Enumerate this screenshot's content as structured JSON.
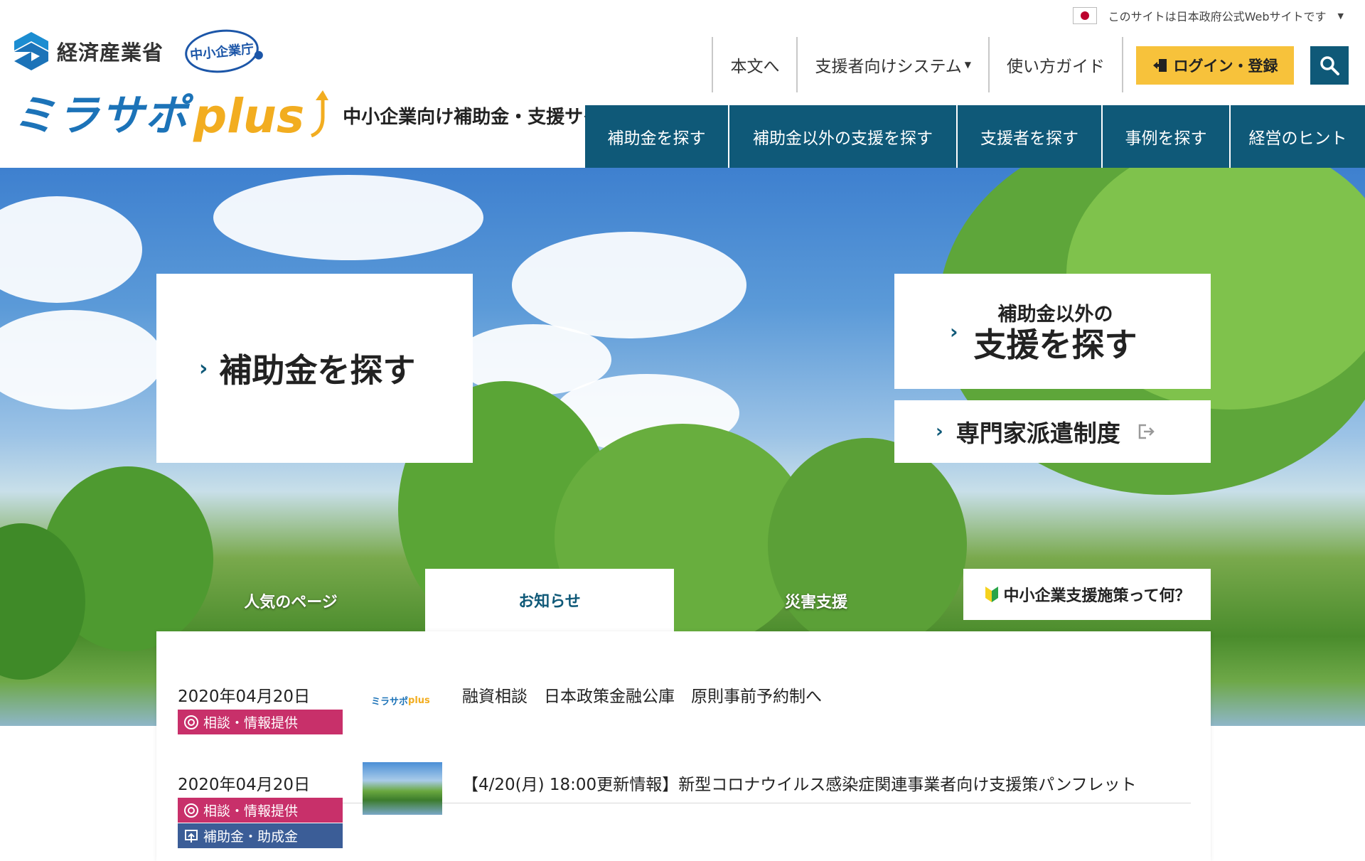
{
  "gov_banner": {
    "text": "このサイトは日本政府公式Webサイトです"
  },
  "header": {
    "meti_name": "経済産業省",
    "sme_agency": "中小企業庁",
    "brand_name": "ミラサポ",
    "brand_plus": "plus",
    "tagline": "中小企業向け補助金・支援サイト"
  },
  "util_nav": {
    "skip": "本文へ",
    "supporter_system": "支援者向けシステム",
    "guide": "使い方ガイド",
    "login": "ログイン・登録"
  },
  "main_nav": [
    "補助金を探す",
    "補助金以外の支援を探す",
    "支援者を探す",
    "事例を探す",
    "経営のヒント"
  ],
  "hero": {
    "subsidy": "補助金を探す",
    "other_line1": "補助金以外の",
    "other_line2": "支援を探す",
    "expert": "専門家派遣制度"
  },
  "tabs": {
    "popular": "人気のページ",
    "news": "お知らせ",
    "disaster": "災害支援",
    "what_is": "中小企業支援施策って何？"
  },
  "news": [
    {
      "date": "2020年04月20日",
      "tags": [
        "相談・情報提供"
      ],
      "thumb_brand": "ミラサポ",
      "thumb_plus": "plus",
      "title": "融資相談　日本政策金融公庫　原則事前予約制へ"
    },
    {
      "date": "2020年04月20日",
      "tags": [
        "相談・情報提供",
        "補助金・助成金"
      ],
      "title": "【4/20(月) 18:00更新情報】新型コロナウイルス感染症関連事業者向け支援策パンフレット"
    }
  ],
  "colors": {
    "brand_blue": "#1c73b8",
    "nav_teal": "#0f5978",
    "login_yellow": "#f7c23b",
    "tag_pink": "#c8306a",
    "tag_blue": "#3b5d97"
  }
}
